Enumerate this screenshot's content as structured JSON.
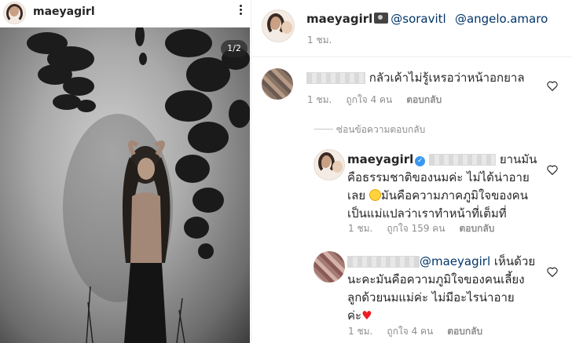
{
  "post": {
    "username": "maeyagirl",
    "image_counter": "1/2",
    "caption_username": "maeyagirl",
    "caption_tags": [
      "@soravitl",
      "@angelo.amaro"
    ],
    "time": "1 ชม."
  },
  "comments": [
    {
      "text": "กลัวเค้าไม่รู้เหรอว่าหน้าอกยาล",
      "time": "1 ชม.",
      "likes": "ถูกใจ 4 คน",
      "reply_label": "ตอบกลับ"
    }
  ],
  "hide_replies_label": "ซ่อนข้อความตอบกลับ",
  "replies": [
    {
      "username": "maeyagirl",
      "line1_tail": "ยานมัน",
      "line2": "คือธรรมชาติของนมค่ะ ไม่ได้น่าอาย",
      "line3_before": "เลย",
      "line3_after": "มันคือความภาคภูมิใจของคน",
      "line4": "เป็นแม่แปลว่าเราทำหน้าที่เต็มที่",
      "time": "1 ชม.",
      "likes": "ถูกใจ 159 คน",
      "reply_label": "ตอบกลับ"
    },
    {
      "mention": "@maeyagirl",
      "line1_tail": "เห็นด้วย",
      "line2": "นะคะมันคือความภูมิใจของคนเลี้ยง",
      "line3": "ลูกด้วยนมแม่ค่ะ ไม่มีอะไรน่าอาย",
      "line4": "ค่ะ",
      "time": "1 ชม.",
      "likes": "ถูกใจ 4 คน",
      "reply_label": "ตอบกลับ"
    }
  ],
  "icons": {
    "more": "more-options-icon",
    "camera": "camera-icon",
    "heart": "heart-outline-icon",
    "verified": "verified-badge-icon",
    "emoji": "grinning-sweat-emoji-icon"
  },
  "colors": {
    "link": "#003569",
    "secondary_text": "#8e8e8e",
    "verified": "#3897f0",
    "heart_red": "#ed1c24"
  }
}
